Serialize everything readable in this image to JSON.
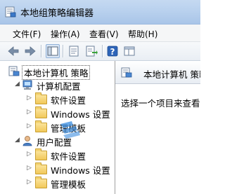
{
  "window": {
    "title": "本地组策略编辑器",
    "title_icon": "group-policy-editor-icon"
  },
  "menu": {
    "items": [
      "文件(F)",
      "操作(A)",
      "查看(V)",
      "帮助(H)"
    ]
  },
  "toolbar": {
    "buttons": [
      "back-arrow-icon",
      "forward-arrow-icon",
      "show-hide-console-tree-icon",
      "properties-icon",
      "export-list-icon",
      "help-icon",
      "extended-view-icon"
    ]
  },
  "tree": {
    "root": {
      "label": "本地计算机 策略",
      "icon": "computer-policy-icon"
    },
    "computer_config": {
      "label": "计算机配置",
      "icon": "computer-icon"
    },
    "computer_items": [
      {
        "label": "软件设置"
      },
      {
        "label": "Windows 设置"
      },
      {
        "label": "管理模板"
      }
    ],
    "user_config": {
      "label": "用户配置",
      "icon": "user-icon"
    },
    "user_items": [
      {
        "label": "软件设置"
      },
      {
        "label": "Windows 设置"
      },
      {
        "label": "管理模板"
      }
    ]
  },
  "details": {
    "header_title": "本地计算机 策略",
    "body_text": "选择一个项目来查看它"
  },
  "colors": {
    "titlebar": "#b9d1ee",
    "tree_bg": "#ffffff",
    "folder": "#f1c85a"
  }
}
